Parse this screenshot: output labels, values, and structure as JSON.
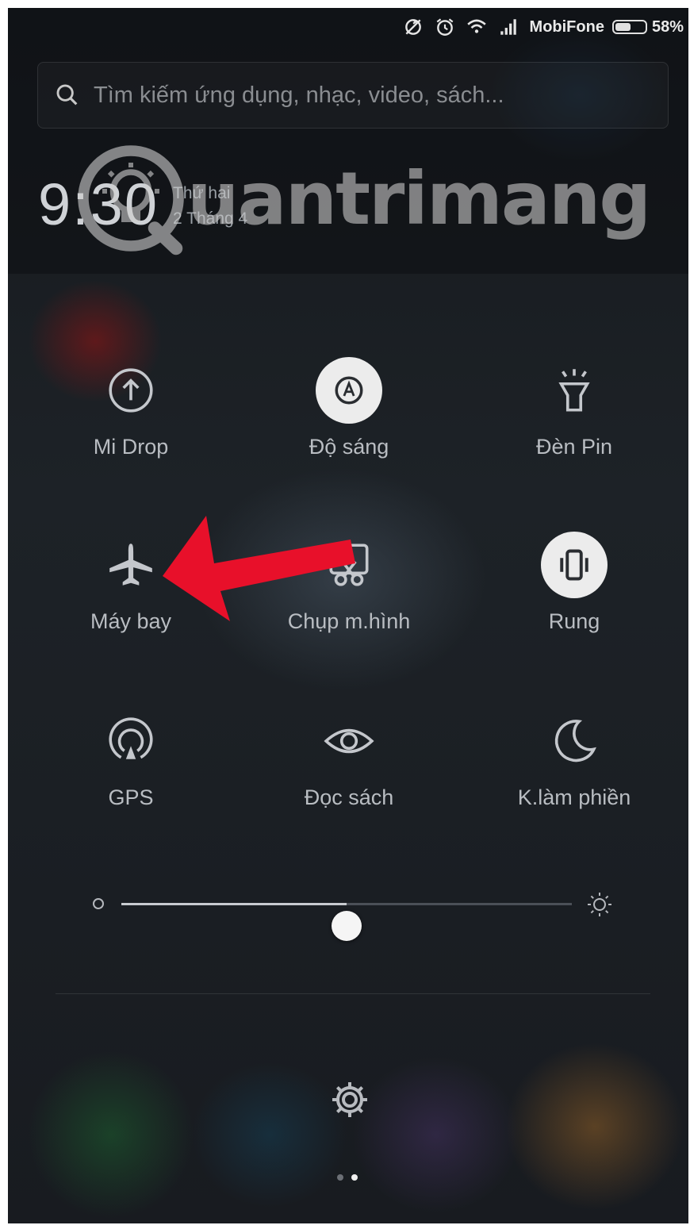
{
  "status_bar": {
    "icons": [
      "sync-off-icon",
      "alarm-icon",
      "wifi-icon",
      "signal-icon"
    ],
    "carrier": "MobiFone",
    "battery_percent": "58%",
    "battery_level": 0.58
  },
  "search": {
    "placeholder": "Tìm kiếm ứng dụng, nhạc, video, sách..."
  },
  "clock": {
    "time": "9:30",
    "day": "Thứ hai",
    "date": "2 Tháng 4"
  },
  "watermark": {
    "text": "uantrimang"
  },
  "toggles": [
    {
      "label": "Mi Drop",
      "icon": "mi-drop-icon",
      "active": false
    },
    {
      "label": "Độ sáng",
      "icon": "auto-brightness-icon",
      "active": true
    },
    {
      "label": "Đèn Pin",
      "icon": "flashlight-icon",
      "active": false
    },
    {
      "label": "Máy bay",
      "icon": "airplane-icon",
      "active": false
    },
    {
      "label": "Chụp m.hình",
      "icon": "screenshot-icon",
      "active": false
    },
    {
      "label": "Rung",
      "icon": "vibrate-icon",
      "active": true
    },
    {
      "label": "GPS",
      "icon": "gps-icon",
      "active": false
    },
    {
      "label": "Đọc sách",
      "icon": "eye-icon",
      "active": false
    },
    {
      "label": "K.làm phiền",
      "icon": "moon-icon",
      "active": false
    }
  ],
  "brightness": {
    "level": 0.5
  },
  "pager": {
    "pages": 2,
    "current": 2
  },
  "colors": {
    "annotation_arrow": "#e8102a",
    "active_toggle_bg": "#ececec"
  }
}
